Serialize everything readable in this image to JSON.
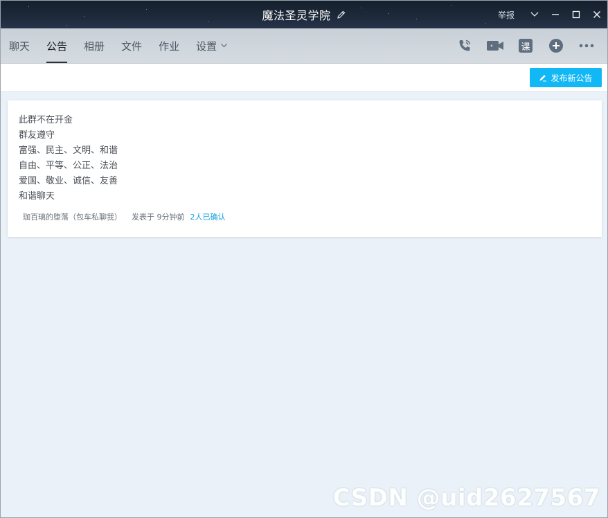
{
  "window": {
    "title": "魔法圣灵学院",
    "report_label": "举报"
  },
  "tabs": [
    {
      "label": "聊天"
    },
    {
      "label": "公告",
      "active": true
    },
    {
      "label": "相册"
    },
    {
      "label": "文件"
    },
    {
      "label": "作业"
    },
    {
      "label": "设置"
    }
  ],
  "toolbar": {
    "icons": [
      "phone-icon",
      "video-icon",
      "ke-course-icon",
      "add-icon",
      "more-icon"
    ],
    "course_glyph": "课"
  },
  "actions": {
    "publish_label": "发布新公告"
  },
  "announcement": {
    "lines": [
      "此群不在开金",
      "群友遵守",
      "富强、民主、文明、和谐",
      "自由、平等、公正、法治",
      "爱国、敬业、诚信、友善",
      "和谐聊天"
    ],
    "author": "珈百璃的堕落（包车私聊我）",
    "time": "发表于  9分钟前",
    "confirmed": "2人已确认"
  },
  "watermark": "CSDN @uid2627567",
  "colors": {
    "accent": "#12b7f5",
    "link": "#12a0e0",
    "title_bar": "#1e2a3a",
    "tab_bar": "#cfd5db",
    "background": "#eaf1f8"
  }
}
